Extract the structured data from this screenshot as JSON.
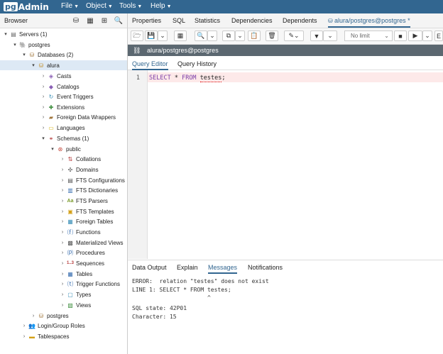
{
  "app": {
    "logo_pg": "pg",
    "logo_admin": "Admin",
    "menu": [
      "File",
      "Object",
      "Tools",
      "Help"
    ]
  },
  "browser": {
    "title": "Browser",
    "tree": [
      {
        "label": "Servers (1)",
        "icon": "server-group-icon"
      },
      {
        "label": "postgres",
        "icon": "elephant-icon"
      },
      {
        "label": "Databases (2)",
        "icon": "databases-icon"
      },
      {
        "label": "alura",
        "icon": "database-icon"
      },
      {
        "label": "Casts",
        "icon": "casts-icon"
      },
      {
        "label": "Catalogs",
        "icon": "catalogs-icon"
      },
      {
        "label": "Event Triggers",
        "icon": "event-triggers-icon"
      },
      {
        "label": "Extensions",
        "icon": "extensions-icon"
      },
      {
        "label": "Foreign Data Wrappers",
        "icon": "fdw-icon"
      },
      {
        "label": "Languages",
        "icon": "languages-icon"
      },
      {
        "label": "Schemas (1)",
        "icon": "schemas-icon"
      },
      {
        "label": "public",
        "icon": "schema-icon"
      },
      {
        "label": "Collations",
        "icon": "collations-icon"
      },
      {
        "label": "Domains",
        "icon": "domains-icon"
      },
      {
        "label": "FTS Configurations",
        "icon": "fts-config-icon"
      },
      {
        "label": "FTS Dictionaries",
        "icon": "fts-dict-icon"
      },
      {
        "label": "FTS Parsers",
        "icon": "fts-parser-icon"
      },
      {
        "label": "FTS Templates",
        "icon": "fts-template-icon"
      },
      {
        "label": "Foreign Tables",
        "icon": "foreign-table-icon"
      },
      {
        "label": "Functions",
        "icon": "function-icon"
      },
      {
        "label": "Materialized Views",
        "icon": "matview-icon"
      },
      {
        "label": "Procedures",
        "icon": "procedure-icon"
      },
      {
        "label": "Sequences",
        "icon": "sequence-icon"
      },
      {
        "label": "Tables",
        "icon": "table-icon"
      },
      {
        "label": "Trigger Functions",
        "icon": "trigger-function-icon"
      },
      {
        "label": "Types",
        "icon": "type-icon"
      },
      {
        "label": "Views",
        "icon": "view-icon"
      },
      {
        "label": "postgres",
        "icon": "database-icon"
      },
      {
        "label": "Login/Group Roles",
        "icon": "roles-icon"
      },
      {
        "label": "Tablespaces",
        "icon": "tablespaces-icon"
      }
    ]
  },
  "tabs": [
    "Properties",
    "SQL",
    "Statistics",
    "Dependencies",
    "Dependents",
    "alura/postgres@postgres *"
  ],
  "toolbar": {
    "limit": "No limit"
  },
  "connection": {
    "label": "alura/postgres@postgres"
  },
  "query_tabs": [
    "Query Editor",
    "Query History"
  ],
  "editor": {
    "line_number": "1",
    "kw_select": "SELECT",
    "star": " * ",
    "kw_from": "FROM",
    "table": "testes",
    "semicolon": ";"
  },
  "output_tabs": [
    "Data Output",
    "Explain",
    "Messages",
    "Notifications"
  ],
  "messages": {
    "line1": "ERROR:  relation \"testes\" does not exist",
    "line2": "LINE 1: SELECT * FROM testes;",
    "line3": "                      ^",
    "line4": "SQL state: 42P01",
    "line5": "Character: 15"
  },
  "colors": {
    "brand": "#326690",
    "connection_bar": "#5b6770",
    "error_line": "#fde9e9"
  }
}
